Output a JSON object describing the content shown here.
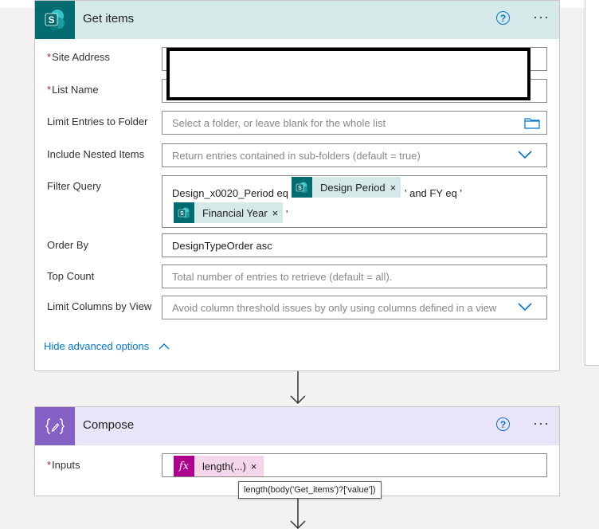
{
  "get_items": {
    "title": "Get items",
    "help": "?",
    "more": "···",
    "site_address_label": "Site Address",
    "list_name_label": "List Name",
    "required_mark": "*",
    "limit_folder_label": "Limit Entries to Folder",
    "limit_folder_placeholder": "Select a folder, or leave blank for the whole list",
    "nested_label": "Include Nested Items",
    "nested_placeholder": "Return entries contained in sub-folders (default = true)",
    "filter_label": "Filter Query",
    "filter_text_1": "Design_x0020_Period eq '",
    "filter_token_1": "Design Period",
    "filter_text_2": "' and FY eq '",
    "filter_token_2": "Financial Year",
    "filter_text_3": "'",
    "order_label": "Order By",
    "order_value": "DesignTypeOrder asc",
    "top_label": "Top Count",
    "top_placeholder": "Total number of entries to retrieve (default = all).",
    "view_label": "Limit Columns by View",
    "view_placeholder": "Avoid column threshold issues by only using columns defined in a view",
    "hide_advanced": "Hide advanced options"
  },
  "compose": {
    "title": "Compose",
    "help": "?",
    "more": "···",
    "inputs_label": "Inputs",
    "required_mark": "*",
    "fx_token": "length(...)",
    "tooltip": "length(body('Get_items')?['value'])"
  },
  "token_close": "×",
  "colors": {
    "sharepoint": "#036c70",
    "compose": "#8661c5",
    "expression": "#ad008c",
    "link": "#0078d4"
  }
}
